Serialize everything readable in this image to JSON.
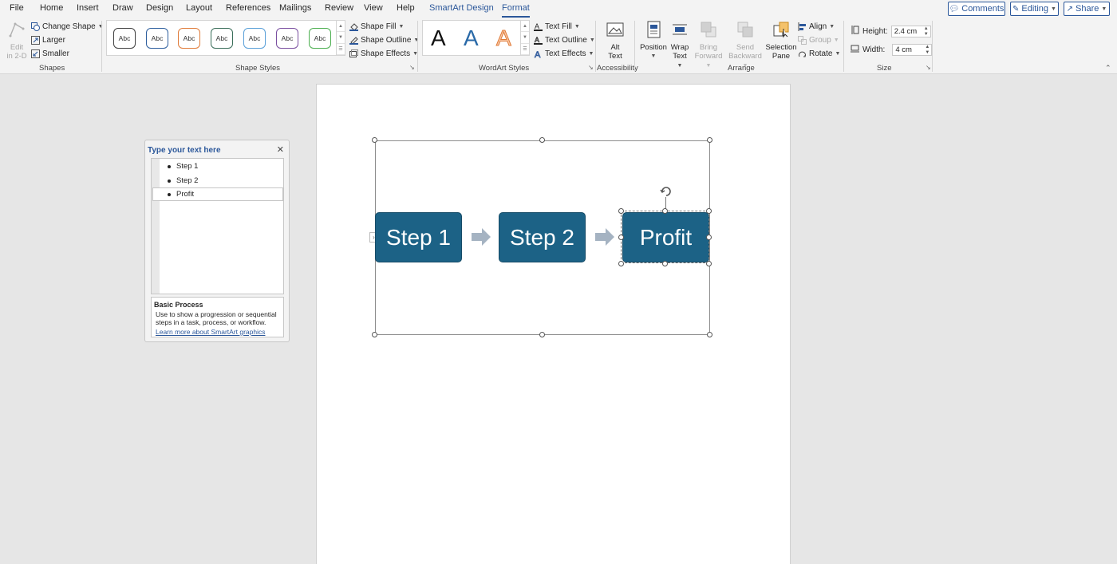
{
  "menu": {
    "file": "File",
    "home": "Home",
    "insert": "Insert",
    "draw": "Draw",
    "design": "Design",
    "layout": "Layout",
    "references": "References",
    "mailings": "Mailings",
    "review": "Review",
    "view": "View",
    "help": "Help",
    "smartart_design": "SmartArt Design",
    "format": "Format"
  },
  "top_actions": {
    "comments": "Comments",
    "editing": "Editing",
    "share": "Share"
  },
  "ribbon": {
    "shapes": {
      "edit_2d_line1": "Edit",
      "edit_2d_line2": "in 2-D",
      "change_shape": "Change Shape",
      "larger": "Larger",
      "smaller": "Smaller",
      "label": "Shapes"
    },
    "shape_styles": {
      "swatch_text": "Abc",
      "swatch_colors": [
        "#404040",
        "#2e5f9e",
        "#e07b39",
        "#3a6e5a",
        "#5aa0d8",
        "#7a4fa0",
        "#4caf50"
      ],
      "shape_fill": "Shape Fill",
      "shape_outline": "Shape Outline",
      "shape_effects": "Shape Effects",
      "label": "Shape Styles"
    },
    "wordart": {
      "sample": "A",
      "text_fill": "Text Fill",
      "text_outline": "Text Outline",
      "text_effects": "Text Effects",
      "label": "WordArt Styles"
    },
    "accessibility": {
      "alt_text_line1": "Alt",
      "alt_text_line2": "Text",
      "label": "Accessibility"
    },
    "arrange": {
      "position": "Position",
      "wrap_line1": "Wrap",
      "wrap_line2": "Text",
      "bring_line1": "Bring",
      "bring_line2": "Forward",
      "send_line1": "Send",
      "send_line2": "Backward",
      "selection_line1": "Selection",
      "selection_line2": "Pane",
      "align": "Align",
      "group": "Group",
      "rotate": "Rotate",
      "label": "Arrange"
    },
    "size": {
      "height_label": "Height:",
      "height_value": "2.4 cm",
      "width_label": "Width:",
      "width_value": "4 cm",
      "label": "Size"
    }
  },
  "text_pane": {
    "title": "Type your text here",
    "items": [
      "Step 1",
      "Step 2",
      "Profit"
    ],
    "layout_name": "Basic Process",
    "layout_desc": "Use to show a progression or sequential steps in a task, process, or workflow.",
    "learn_more": "Learn more about SmartArt graphics"
  },
  "smartart": {
    "boxes": [
      "Step 1",
      "Step 2",
      "Profit"
    ],
    "box_color": "#1c6286",
    "arrow_color": "#a5b3c2"
  }
}
